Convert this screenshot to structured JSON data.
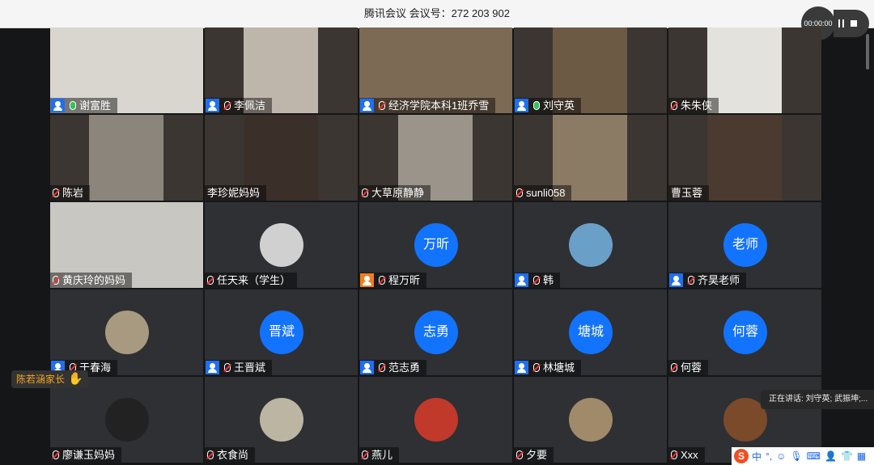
{
  "window": {
    "title": "腾讯会议 会议号：272 203 902",
    "timer": "00:00:00"
  },
  "toast": {
    "name": "陈若涵家长",
    "icon": "wave-hand-icon"
  },
  "speaking": {
    "text": "正在讲话: 刘守英; 武振坤;..."
  },
  "ime": {
    "logo": "S",
    "keys": [
      "中",
      "°,",
      "☺",
      "🎙",
      "⌨",
      "👤",
      "👕",
      "▦"
    ]
  },
  "participants": [
    {
      "name": "谢富胜",
      "host": true,
      "mic": "on"
    },
    {
      "name": "李佩洁",
      "host": true,
      "mic": "muted"
    },
    {
      "name": "经济学院本科1班乔雪",
      "host": true,
      "mic": "muted"
    },
    {
      "name": "刘守英",
      "host": true,
      "mic": "on"
    },
    {
      "name": "朱朱侠",
      "host": false,
      "mic": "muted"
    },
    {
      "name": "陈岩",
      "host": false,
      "mic": "muted"
    },
    {
      "name": "李珍妮妈妈",
      "host": false,
      "mic": "none"
    },
    {
      "name": "大草原静静",
      "host": false,
      "mic": "muted"
    },
    {
      "name": "sunli058",
      "host": false,
      "mic": "muted"
    },
    {
      "name": "曹玉蓉",
      "host": false,
      "mic": "none"
    },
    {
      "name": "黄庆玲的妈妈",
      "host": false,
      "mic": "muted"
    },
    {
      "name": "任天来（学生）",
      "host": false,
      "mic": "muted"
    },
    {
      "name": "程万昕",
      "host": true,
      "mic": "muted",
      "avatar": "万昕"
    },
    {
      "name": "韩",
      "host": true,
      "mic": "muted"
    },
    {
      "name": "齐昊老师",
      "host": true,
      "mic": "muted",
      "avatar": "老师"
    },
    {
      "name": "于春海",
      "host": true,
      "mic": "muted"
    },
    {
      "name": "王晋斌",
      "host": true,
      "mic": "muted",
      "avatar": "晋斌"
    },
    {
      "name": "范志勇",
      "host": true,
      "mic": "muted",
      "avatar": "志勇"
    },
    {
      "name": "林塘城",
      "host": true,
      "mic": "muted",
      "avatar": "塘城"
    },
    {
      "name": "何蓉",
      "host": false,
      "mic": "muted",
      "avatar": "何蓉"
    },
    {
      "name": "廖谦玉妈妈",
      "host": false,
      "mic": "muted"
    },
    {
      "name": "衣食尚",
      "host": false,
      "mic": "muted"
    },
    {
      "name": "燕儿",
      "host": false,
      "mic": "muted"
    },
    {
      "name": "夕要",
      "host": false,
      "mic": "muted"
    },
    {
      "name": "Xxx",
      "host": false,
      "mic": "muted"
    }
  ]
}
